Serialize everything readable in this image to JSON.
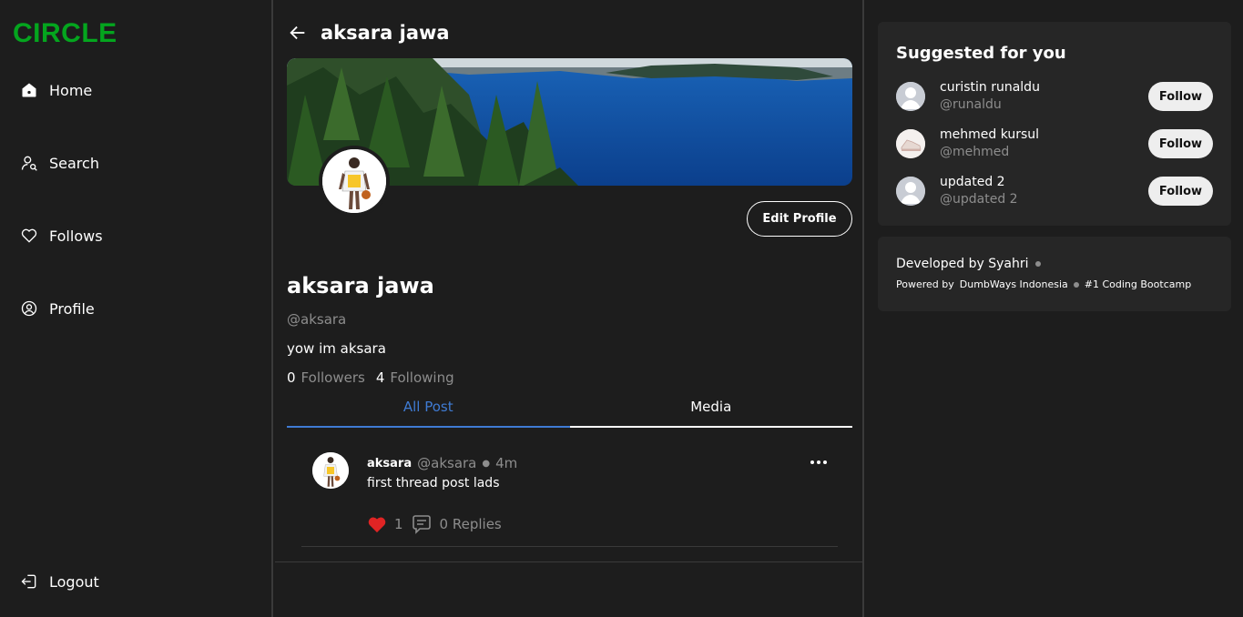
{
  "brand": {
    "logo": "CIRCLE",
    "accent": "#04a51e"
  },
  "nav": {
    "home": "Home",
    "search": "Search",
    "follows": "Follows",
    "profile": "Profile",
    "logout": "Logout"
  },
  "header": {
    "title": "aksara jawa"
  },
  "profile": {
    "name": "aksara jawa",
    "handle": "@aksara",
    "bio": "yow im aksara",
    "followers_count": "0",
    "followers_label": "Followers",
    "following_count": "4",
    "following_label": "Following",
    "edit_label": "Edit Profile"
  },
  "tabs": [
    {
      "label": "All Post",
      "active": true
    },
    {
      "label": "Media",
      "active": false
    }
  ],
  "post": {
    "author": "aksara",
    "handle": "@aksara",
    "time": "4m",
    "text": "first thread post lads",
    "likes": "1",
    "replies": "0 Replies"
  },
  "suggested": {
    "title": "Suggested for you",
    "follow_label": "Follow",
    "users": [
      {
        "name": "curistin runaldu",
        "handle": "@runaldu"
      },
      {
        "name": "mehmed kursul",
        "handle": "@mehmed"
      },
      {
        "name": "updated 2",
        "handle": "@updated 2"
      }
    ]
  },
  "footer": {
    "developed_by": "Developed by Syahri",
    "powered_by": "Powered by",
    "company": "DumbWays Indonesia",
    "tagline": "#1 Coding Bootcamp"
  },
  "colors": {
    "active_tab": "#3f7bd3",
    "like": "#e02424",
    "background": "#1d1d1d",
    "card": "#262626"
  }
}
